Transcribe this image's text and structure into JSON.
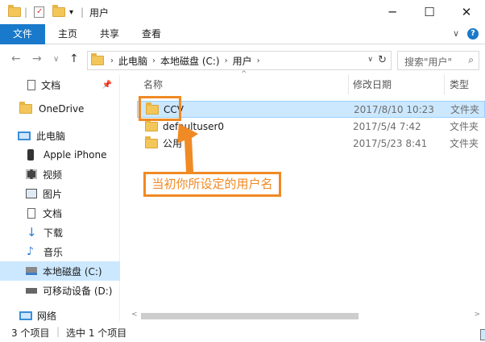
{
  "window": {
    "title": "用户",
    "minimize": "─",
    "maximize": "☐",
    "close": "✕"
  },
  "ribbon": {
    "tabs": [
      "文件",
      "主页",
      "共享",
      "查看"
    ],
    "expand": "∨",
    "help": "?"
  },
  "nav": {
    "back": "←",
    "forward": "→",
    "dropdown": "∨",
    "up": "↑"
  },
  "address": {
    "segments": [
      "此电脑",
      "本地磁盘 (C:)",
      "用户"
    ],
    "sep": "›",
    "dropdown": "∨",
    "refresh": "↻"
  },
  "search": {
    "placeholder": "搜索\"用户\"",
    "icon": "⌕"
  },
  "sidebar": {
    "items": [
      {
        "label": "文档",
        "icon": "document-icon"
      },
      {
        "label": "OneDrive",
        "icon": "folder-icon"
      },
      {
        "label": "此电脑",
        "icon": "computer-icon"
      },
      {
        "label": "Apple iPhone",
        "icon": "phone-icon"
      },
      {
        "label": "视频",
        "icon": "video-icon"
      },
      {
        "label": "图片",
        "icon": "picture-icon"
      },
      {
        "label": "文档",
        "icon": "document-icon"
      },
      {
        "label": "下载",
        "icon": "download-icon"
      },
      {
        "label": "音乐",
        "icon": "music-icon"
      },
      {
        "label": "本地磁盘 (C:)",
        "icon": "drive-icon"
      },
      {
        "label": "可移动设备 (D:)",
        "icon": "usb-drive-icon"
      },
      {
        "label": "网络",
        "icon": "network-icon"
      }
    ],
    "pin": "📌"
  },
  "columns": {
    "name": "名称",
    "date": "修改日期",
    "type": "类型",
    "sort": "^"
  },
  "files": [
    {
      "name": "CCV",
      "date": "2017/8/10 10:23",
      "type": "文件夹"
    },
    {
      "name": "defaultuser0",
      "date": "2017/5/4 7:42",
      "type": "文件夹"
    },
    {
      "name": "公用",
      "date": "2017/5/23 8:41",
      "type": "文件夹"
    }
  ],
  "annotation": {
    "text": "当初你所设定的用户名"
  },
  "scroll": {
    "left": "<",
    "right": ">"
  },
  "status": {
    "count": "3 个项目",
    "selected": "选中 1 个项目"
  },
  "colors": {
    "accent": "#1979ca",
    "selection": "#cce8ff",
    "annotation": "#f08a24",
    "folder": "#f3c65a"
  }
}
